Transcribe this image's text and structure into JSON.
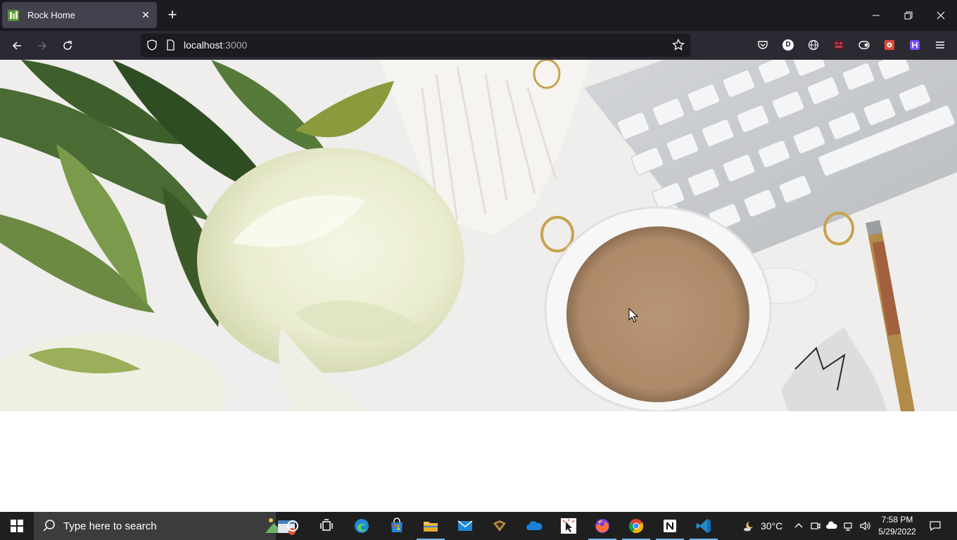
{
  "browser": {
    "tab": {
      "title": "Rock Home"
    },
    "url": {
      "host": "localhost",
      "port": ":3000"
    }
  },
  "taskbar": {
    "search_placeholder": "Type here to search",
    "weather": {
      "temp": "30°C",
      "icon": "moon-cloud-icon"
    },
    "clock": {
      "time": "7:58 PM",
      "date": "5/29/2022"
    }
  },
  "colors": {
    "titlebar": "#1c1b22",
    "toolbar": "#2b2a33",
    "tab_active": "#42414d",
    "taskbar": "#1f1f1f"
  }
}
